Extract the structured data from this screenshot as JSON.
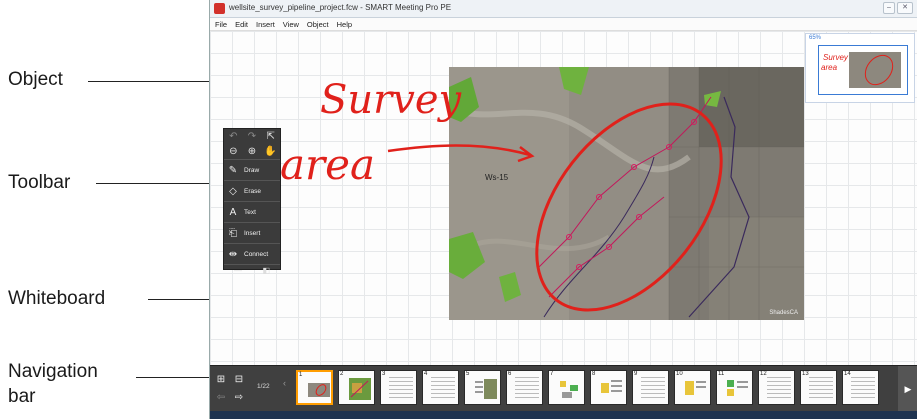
{
  "callouts": {
    "object": "Object",
    "toolbar": "Toolbar",
    "whiteboard": "Whiteboard",
    "navigation_line1": "Navigation",
    "navigation_line2": "bar"
  },
  "window": {
    "title": "wellsite_survey_pipeline_project.fcw - SMART Meeting Pro PE",
    "minimize_glyph": "–",
    "close_glyph": "✕"
  },
  "menu": [
    "File",
    "Edit",
    "Insert",
    "View",
    "Object",
    "Help"
  ],
  "preview": {
    "zoom": "65%"
  },
  "map": {
    "label": "Ws-15",
    "caption": "ShadesCA",
    "annotation_line1": "Survey",
    "annotation_line2": "area",
    "annotation_color": "#e0211b"
  },
  "toolbar": {
    "items": [
      {
        "icon": "pen-icon",
        "label": "Draw"
      },
      {
        "icon": "eraser-icon",
        "label": "Erase"
      },
      {
        "icon": "text-icon",
        "label": "Text"
      },
      {
        "icon": "insert-icon",
        "label": "Insert"
      },
      {
        "icon": "connect-icon",
        "label": "Connect"
      }
    ],
    "footer_left": "—",
    "footer_right": "◧"
  },
  "navigation": {
    "page_count": "1/22",
    "thumbnails": [
      "1",
      "2",
      "3",
      "4",
      "5",
      "6",
      "7",
      "8",
      "9",
      "10",
      "11",
      "12",
      "13",
      "14"
    ],
    "active_page": "1",
    "next_glyph": "▶",
    "prev_glyph": "‹"
  }
}
